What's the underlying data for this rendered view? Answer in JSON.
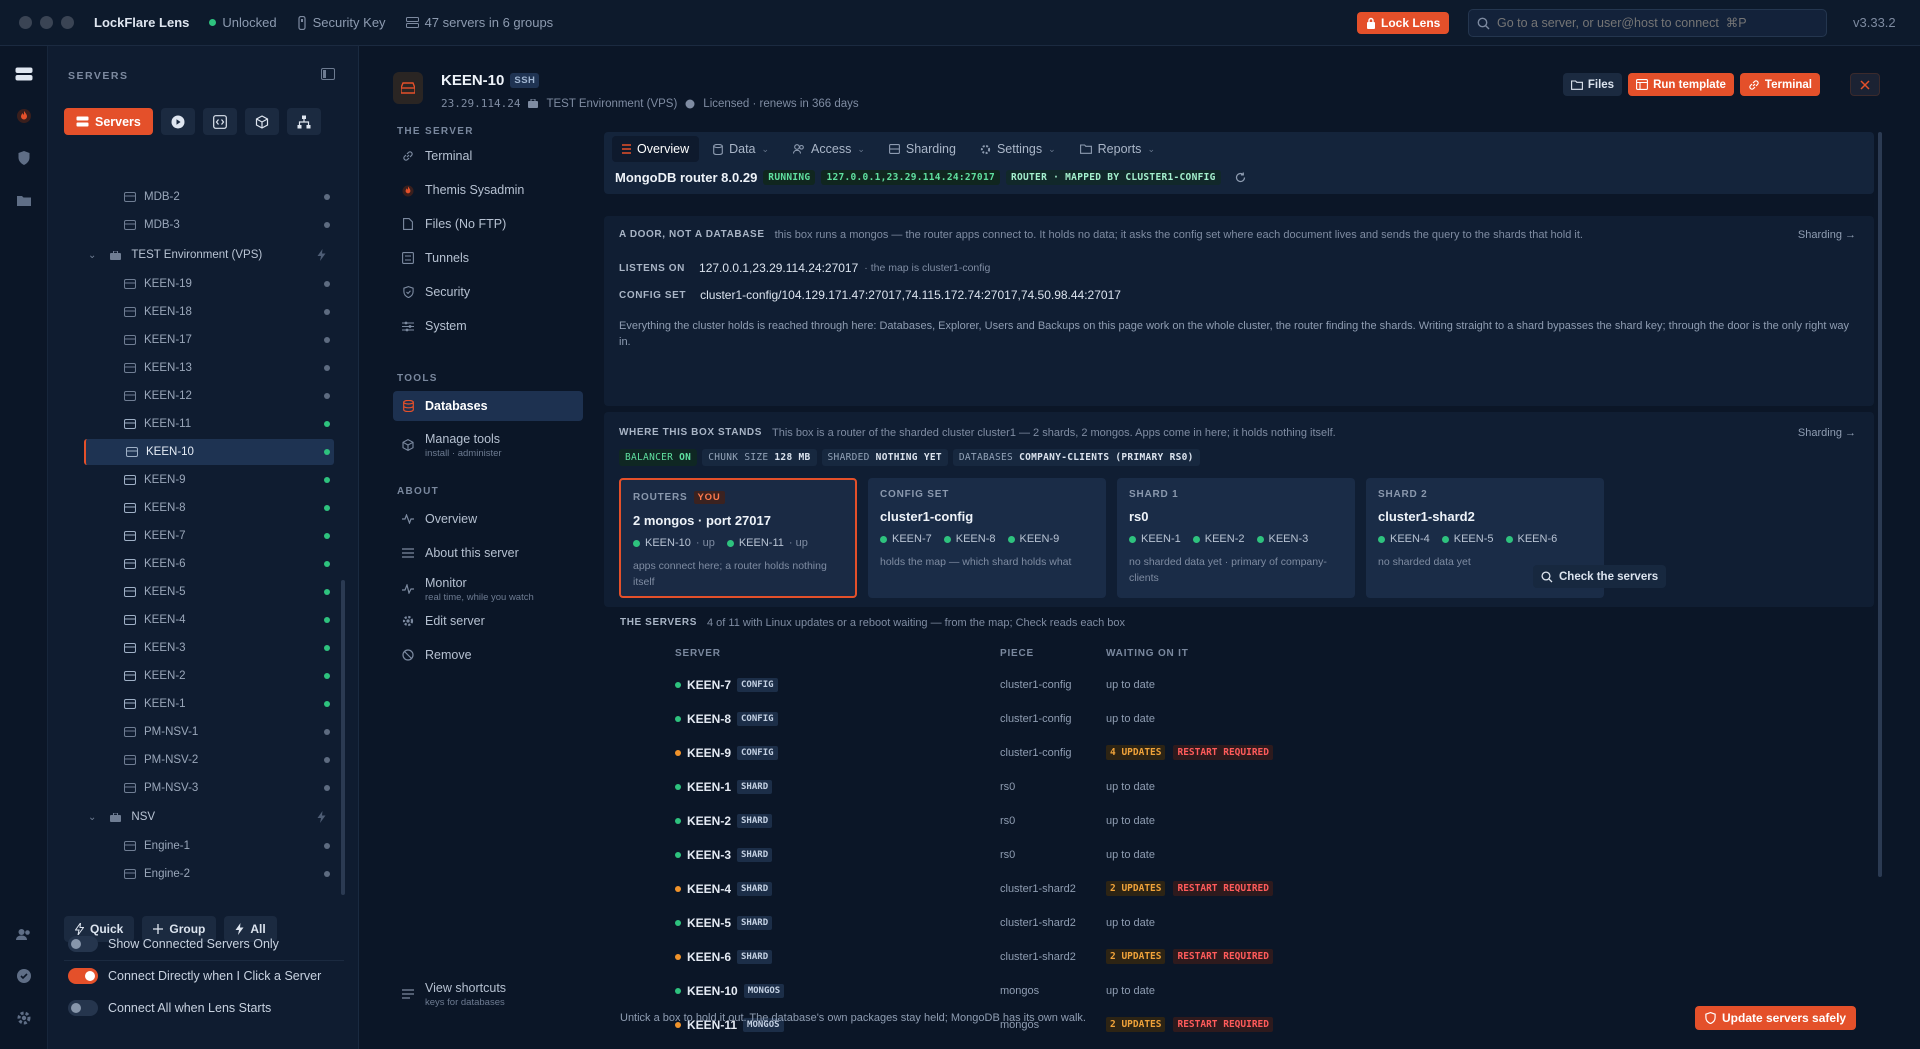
{
  "titlebar": {
    "app_name": "LockFlare Lens",
    "status": "Unlocked",
    "key": "Security Key",
    "servers_summary": "47 servers in 6 groups",
    "lock_button": "Lock Lens",
    "search_placeholder": "Go to a server, or user@host to connect  ⌘P",
    "version": "v3.33.2"
  },
  "sidebar": {
    "heading": "SERVERS",
    "servers_tab": "Servers",
    "tree": [
      {
        "label": "MDB-2",
        "type": "server",
        "status": "gray"
      },
      {
        "label": "MDB-3",
        "type": "server",
        "status": "gray"
      },
      {
        "label": "TEST Environment (VPS)",
        "type": "group"
      },
      {
        "label": "KEEN-19",
        "type": "server",
        "status": "gray"
      },
      {
        "label": "KEEN-18",
        "type": "server",
        "status": "gray"
      },
      {
        "label": "KEEN-17",
        "type": "server",
        "status": "gray"
      },
      {
        "label": "KEEN-13",
        "type": "server",
        "status": "gray"
      },
      {
        "label": "KEEN-12",
        "type": "server",
        "status": "gray"
      },
      {
        "label": "KEEN-11",
        "type": "server",
        "status": "green"
      },
      {
        "label": "KEEN-10",
        "type": "server",
        "status": "green",
        "selected": true
      },
      {
        "label": "KEEN-9",
        "type": "server",
        "status": "green"
      },
      {
        "label": "KEEN-8",
        "type": "server",
        "status": "green"
      },
      {
        "label": "KEEN-7",
        "type": "server",
        "status": "green"
      },
      {
        "label": "KEEN-6",
        "type": "server",
        "status": "green"
      },
      {
        "label": "KEEN-5",
        "type": "server",
        "status": "green"
      },
      {
        "label": "KEEN-4",
        "type": "server",
        "status": "green"
      },
      {
        "label": "KEEN-3",
        "type": "server",
        "status": "green"
      },
      {
        "label": "KEEN-2",
        "type": "server",
        "status": "green"
      },
      {
        "label": "KEEN-1",
        "type": "server",
        "status": "green"
      },
      {
        "label": "PM-NSV-1",
        "type": "server",
        "status": "gray"
      },
      {
        "label": "PM-NSV-2",
        "type": "server",
        "status": "gray"
      },
      {
        "label": "PM-NSV-3",
        "type": "server",
        "status": "gray"
      },
      {
        "label": "NSV",
        "type": "group"
      },
      {
        "label": "Engine-1",
        "type": "server",
        "status": "gray"
      },
      {
        "label": "Engine-2",
        "type": "server",
        "status": "gray"
      }
    ],
    "quick": "Quick",
    "group": "Group",
    "all": "All",
    "toggles": [
      {
        "label": "Show Connected Servers Only",
        "on": false
      },
      {
        "label": "Connect Directly when I Click a Server",
        "on": true
      },
      {
        "label": "Connect All when Lens Starts",
        "on": false
      }
    ]
  },
  "header": {
    "name": "KEEN-10",
    "badge": "SSH",
    "ip": "23.29.114.24",
    "env": "TEST Environment (VPS)",
    "license": "Licensed · renews in 366 days",
    "files": "Files",
    "run_template": "Run template",
    "terminal": "Terminal"
  },
  "nav": {
    "the_server": "THE SERVER",
    "items1": [
      "Terminal",
      "Themis Sysadmin",
      "Files (No FTP)",
      "Tunnels",
      "Security",
      "System"
    ],
    "tools": "TOOLS",
    "databases": "Databases",
    "manage_tools": "Manage tools",
    "manage_tools_sub": "install · administer",
    "about": "ABOUT",
    "overview": "Overview",
    "about_server": "About this server",
    "monitor": "Monitor",
    "monitor_sub": "real time, while you watch",
    "edit": "Edit server",
    "remove": "Remove",
    "shortcuts": "View shortcuts",
    "shortcuts_sub": "keys for databases"
  },
  "tabs": [
    "Overview",
    "Data",
    "Access",
    "Sharding",
    "Settings",
    "Reports"
  ],
  "status": {
    "product": "MongoDB router 8.0.29",
    "running": "RUNNING",
    "addr": "127.0.0.1,23.29.114.24:27017",
    "mapped": "ROUTER · MAPPED BY CLUSTER1-CONFIG"
  },
  "door": {
    "title": "A DOOR, NOT A DATABASE",
    "desc": "this box runs a mongos — the router apps connect to. It holds no data; it asks the config set where each document lives and sends the query to the shards that hold it.",
    "link": "Sharding →",
    "listens_label": "LISTENS ON",
    "listens_value": "127.0.0.1,23.29.114.24:27017",
    "listens_note": "· the map is cluster1-config",
    "config_label": "CONFIG SET",
    "config_value": "cluster1-config/104.129.171.47:27017,74.115.172.74:27017,74.50.98.44:27017",
    "paragraph": "Everything the cluster holds is reached through here: Databases, Explorer, Users and Backups on this page work on the whole cluster, the router finding the shards. Writing straight to a shard bypasses the shard key; through the door is the only right way in."
  },
  "stands": {
    "title": "WHERE THIS BOX STANDS",
    "desc": "This box is a router of the sharded cluster cluster1 — 2 shards, 2 mongos. Apps come in here; it holds nothing itself.",
    "link": "Sharding →",
    "chips": [
      {
        "k": "BALANCER",
        "v": "ON"
      },
      {
        "k": "CHUNK SIZE",
        "v": "128 MB"
      },
      {
        "k": "SHARDED",
        "v": "NOTHING YET"
      },
      {
        "k": "DATABASES",
        "v": "COMPANY-CLIENTS (PRIMARY RS0)"
      }
    ],
    "cards": [
      {
        "title": "ROUTERS",
        "you": "YOU",
        "head": "2 mongos · port 27017",
        "members": [
          "KEEN-10",
          "KEEN-11"
        ],
        "member_note": "· up",
        "note": "apps connect here; a router holds nothing itself"
      },
      {
        "title": "CONFIG SET",
        "head": "cluster1-config",
        "members": [
          "KEEN-7",
          "KEEN-8",
          "KEEN-9"
        ],
        "note": "holds the map — which shard holds what"
      },
      {
        "title": "SHARD 1",
        "head": "rs0",
        "members": [
          "KEEN-1",
          "KEEN-2",
          "KEEN-3"
        ],
        "note": "no sharded data yet · primary of company-clients"
      },
      {
        "title": "SHARD 2",
        "head": "cluster1-shard2",
        "members": [
          "KEEN-4",
          "KEEN-5",
          "KEEN-6"
        ],
        "note": "no sharded data yet"
      }
    ]
  },
  "servers": {
    "title": "THE SERVERS",
    "desc": "4 of 11 with Linux updates or a reboot waiting — from the map; Check reads each box",
    "check": "Check the servers",
    "col_server": "SERVER",
    "col_piece": "PIECE",
    "col_waiting": "WAITING ON IT",
    "rows": [
      {
        "name": "KEEN-7",
        "role": "CONFIG",
        "piece": "cluster1-config",
        "wait": "up to date",
        "status": "green"
      },
      {
        "name": "KEEN-8",
        "role": "CONFIG",
        "piece": "cluster1-config",
        "wait": "up to date",
        "status": "green"
      },
      {
        "name": "KEEN-9",
        "role": "CONFIG",
        "piece": "cluster1-config",
        "updates": "4 UPDATES",
        "restart": "RESTART REQUIRED",
        "status": "orange"
      },
      {
        "name": "KEEN-1",
        "role": "SHARD",
        "piece": "rs0",
        "wait": "up to date",
        "status": "green"
      },
      {
        "name": "KEEN-2",
        "role": "SHARD",
        "piece": "rs0",
        "wait": "up to date",
        "status": "green"
      },
      {
        "name": "KEEN-3",
        "role": "SHARD",
        "piece": "rs0",
        "wait": "up to date",
        "status": "green"
      },
      {
        "name": "KEEN-4",
        "role": "SHARD",
        "piece": "cluster1-shard2",
        "updates": "2 UPDATES",
        "restart": "RESTART REQUIRED",
        "status": "orange"
      },
      {
        "name": "KEEN-5",
        "role": "SHARD",
        "piece": "cluster1-shard2",
        "wait": "up to date",
        "status": "green"
      },
      {
        "name": "KEEN-6",
        "role": "SHARD",
        "piece": "cluster1-shard2",
        "updates": "2 UPDATES",
        "restart": "RESTART REQUIRED",
        "status": "orange"
      },
      {
        "name": "KEEN-10",
        "role": "MONGOS",
        "piece": "mongos",
        "wait": "up to date",
        "status": "green"
      },
      {
        "name": "KEEN-11",
        "role": "MONGOS",
        "piece": "mongos",
        "updates": "2 UPDATES",
        "restart": "RESTART REQUIRED",
        "status": "orange"
      }
    ],
    "footnote": "Untick a box to hold it out. The database's own packages stay held; MongoDB has its own walk.",
    "update_button": "Update servers safely"
  }
}
